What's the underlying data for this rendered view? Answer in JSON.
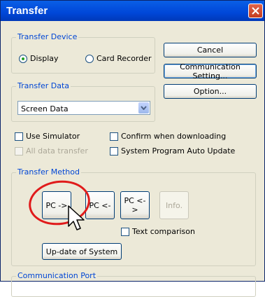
{
  "window": {
    "title": "Transfer"
  },
  "transfer_device": {
    "label": "Transfer Device",
    "options": [
      {
        "label": "Display",
        "selected": true
      },
      {
        "label": "Card Recorder",
        "selected": false
      }
    ]
  },
  "buttons": {
    "cancel": "Cancel",
    "communication_setting": "Communication Setting...",
    "option": "Option..."
  },
  "transfer_data": {
    "label": "Transfer Data",
    "selected": "Screen Data"
  },
  "checkboxes": {
    "use_simulator": "Use Simulator",
    "confirm_downloading": "Confirm when downloading",
    "all_data_transfer": "All data transfer",
    "system_program_update": "System Program Auto Update"
  },
  "transfer_method": {
    "label": "Transfer Method",
    "pc_to": "PC ->",
    "pc_from": "PC <-",
    "pc_both": "PC <->",
    "info": "Info.",
    "text_comparison": "Text comparison",
    "update_system": "Up-date of System"
  },
  "communication_port": {
    "label": "Communication Port"
  },
  "colors": {
    "highlight": "#e01b1b",
    "titlebar": "#0047d8",
    "group_label": "#0046d5"
  }
}
